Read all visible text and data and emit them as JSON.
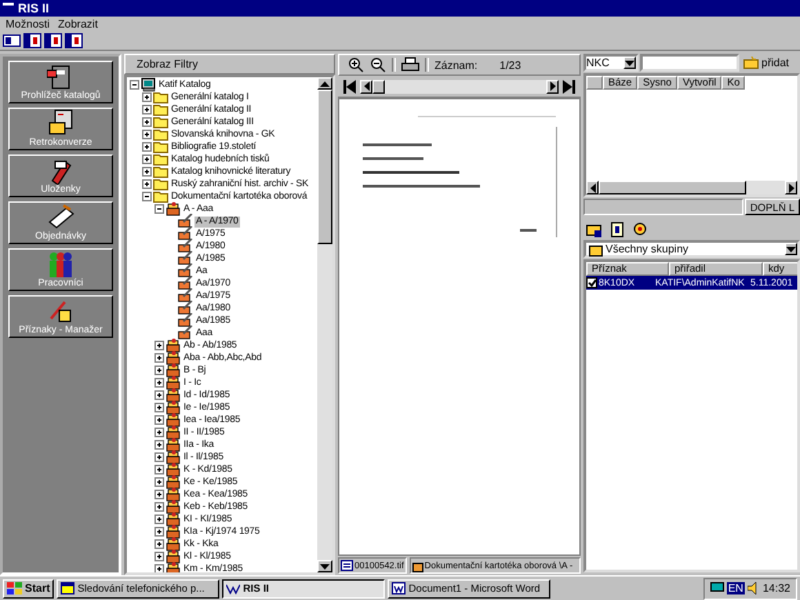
{
  "window": {
    "title": "RIS II"
  },
  "menu": [
    "Možnosti",
    "Zobrazit"
  ],
  "sidebar": {
    "items": [
      {
        "label": "Prohlížeč katalogů",
        "selected": false
      },
      {
        "label": "Retrokonverze",
        "selected": false
      },
      {
        "label": "Uloženky",
        "selected": false
      },
      {
        "label": "Objednávky",
        "selected": false
      },
      {
        "label": "Pracovníci",
        "selected": false
      },
      {
        "label": "Příznaky - Manažer",
        "selected": false
      }
    ]
  },
  "tree_panel": {
    "header": "Zobraz Filtry",
    "tree": [
      {
        "label": "Katif Katalog",
        "kind": "root",
        "expanded": true,
        "selected": false,
        "children": [
          {
            "label": "Generální katalog I",
            "kind": "folder",
            "expanded": false,
            "selected": false
          },
          {
            "label": "Generální katalog II",
            "kind": "folder",
            "expanded": false,
            "selected": false
          },
          {
            "label": "Generální katalog III",
            "kind": "folder",
            "expanded": false,
            "selected": false
          },
          {
            "label": "Slovanská knihovna - GK",
            "kind": "folder",
            "expanded": false,
            "selected": false
          },
          {
            "label": "Bibliografie 19.století",
            "kind": "folder",
            "expanded": false,
            "selected": false
          },
          {
            "label": "Katalog hudebních tisků",
            "kind": "folder",
            "expanded": false,
            "selected": false
          },
          {
            "label": "Katalog knihovnické literatury",
            "kind": "folder",
            "expanded": false,
            "selected": false
          },
          {
            "label": "Ruský zahraniční hist. archiv - SK",
            "kind": "folder",
            "expanded": false,
            "selected": false
          },
          {
            "label": "Dokumentační kartotéka oborová",
            "kind": "folder",
            "expanded": true,
            "selected": false,
            "children": [
              {
                "label": "A - Aaa",
                "kind": "group",
                "expanded": true,
                "selected": false,
                "children": [
                  {
                    "label": "A - A/1970",
                    "kind": "card",
                    "selected": true
                  },
                  {
                    "label": "A/1975",
                    "kind": "card",
                    "selected": false
                  },
                  {
                    "label": "A/1980",
                    "kind": "card",
                    "selected": false
                  },
                  {
                    "label": "A/1985",
                    "kind": "card",
                    "selected": false
                  },
                  {
                    "label": "Aa",
                    "kind": "card",
                    "selected": false
                  },
                  {
                    "label": "Aa/1970",
                    "kind": "card",
                    "selected": false
                  },
                  {
                    "label": "Aa/1975",
                    "kind": "card",
                    "selected": false
                  },
                  {
                    "label": "Aa/1980",
                    "kind": "card",
                    "selected": false
                  },
                  {
                    "label": "Aa/1985",
                    "kind": "card",
                    "selected": false
                  },
                  {
                    "label": "Aaa",
                    "kind": "card",
                    "selected": false
                  }
                ]
              },
              {
                "label": "Ab - Ab/1985",
                "kind": "group",
                "expanded": false,
                "selected": false
              },
              {
                "label": "Aba - Abb,Abc,Abd",
                "kind": "group",
                "expanded": false,
                "selected": false
              },
              {
                "label": "B - Bj",
                "kind": "group",
                "expanded": false,
                "selected": false
              },
              {
                "label": "I - Ic",
                "kind": "group",
                "expanded": false,
                "selected": false
              },
              {
                "label": "Id - Id/1985",
                "kind": "group",
                "expanded": false,
                "selected": false
              },
              {
                "label": "Ie - Ie/1985",
                "kind": "group",
                "expanded": false,
                "selected": false
              },
              {
                "label": "Iea - Iea/1985",
                "kind": "group",
                "expanded": false,
                "selected": false
              },
              {
                "label": "II - II/1985",
                "kind": "group",
                "expanded": false,
                "selected": false
              },
              {
                "label": "IIa - Ika",
                "kind": "group",
                "expanded": false,
                "selected": false
              },
              {
                "label": "Il - Il/1985",
                "kind": "group",
                "expanded": false,
                "selected": false
              },
              {
                "label": "K - Kd/1985",
                "kind": "group",
                "expanded": false,
                "selected": false
              },
              {
                "label": "Ke - Ke/1985",
                "kind": "group",
                "expanded": false,
                "selected": false
              },
              {
                "label": "Kea - Kea/1985",
                "kind": "group",
                "expanded": false,
                "selected": false
              },
              {
                "label": "Keb - Keb/1985",
                "kind": "group",
                "expanded": false,
                "selected": false
              },
              {
                "label": "KI - KI/1985",
                "kind": "group",
                "expanded": false,
                "selected": false
              },
              {
                "label": "KIa - Kj/1974 1975",
                "kind": "group",
                "expanded": false,
                "selected": false
              },
              {
                "label": "Kk - Kka",
                "kind": "group",
                "expanded": false,
                "selected": false
              },
              {
                "label": "Kl - Kl/1985",
                "kind": "group",
                "expanded": false,
                "selected": false
              },
              {
                "label": "Km - Km/1985",
                "kind": "group",
                "expanded": false,
                "selected": false
              }
            ]
          }
        ]
      }
    ]
  },
  "viewer": {
    "record_label": "Záznam:",
    "record_position": "1/23",
    "file_name": "00100542.tif",
    "path": "Dokumentační kartotéka oborová \\A -"
  },
  "search": {
    "base": "NKC",
    "add_button": "přidat"
  },
  "records_table": {
    "columns": [
      "Báze",
      "Sysno",
      "Vytvořil",
      "Ko"
    ],
    "action_button": "DOPLŇ L"
  },
  "flags": {
    "group": "Všechny skupiny",
    "columns": [
      "Příznak",
      "přiřadil",
      "kdy"
    ],
    "rows": [
      {
        "cells": [
          "8K10DX",
          "KATIF\\AdminKatifNK",
          "5.11.2001"
        ],
        "checked": true,
        "selected": true
      }
    ]
  },
  "taskbar": {
    "start": "Start",
    "tasks": [
      {
        "label": "Sledování telefonického p...",
        "selected": false
      },
      {
        "label": "RIS II",
        "selected": true
      },
      {
        "label": "Document1 - Microsoft Word",
        "selected": false
      }
    ],
    "language": "EN",
    "clock": "14:32"
  }
}
